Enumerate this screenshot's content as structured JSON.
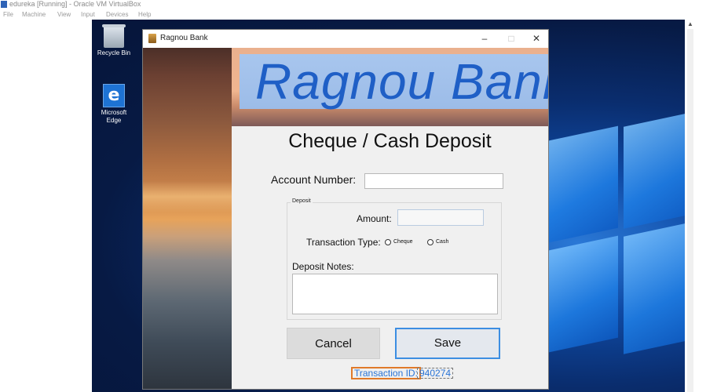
{
  "host": {
    "title": "edureka [Running] - Oracle VM VirtualBox",
    "menu": [
      "File",
      "Machine",
      "View",
      "Input",
      "Devices",
      "Help"
    ]
  },
  "desktop": {
    "icons": [
      {
        "label": "Recycle Bin",
        "icon": "recycle-bin-icon"
      },
      {
        "label": "Microsoft Edge",
        "icon": "edge-icon"
      }
    ]
  },
  "window": {
    "title": "Ragnou Bank",
    "minimize": "–",
    "maximize": "□",
    "close": "✕"
  },
  "banner": {
    "logo_text": "Ragnou Bank"
  },
  "form": {
    "heading": "Cheque / Cash Deposit",
    "account_label": "Account Number:",
    "account_value": "",
    "deposit_group_label": "Deposit",
    "amount_label": "Amount:",
    "amount_value": "",
    "transaction_type_label": "Transaction Type:",
    "radio_cheque": "Cheque",
    "radio_cash": "Cash",
    "notes_label": "Deposit Notes:",
    "notes_value": "",
    "cancel_label": "Cancel",
    "save_label": "Save",
    "transaction_id_label": "Transaction ID:",
    "transaction_id_value": "940274"
  },
  "colors": {
    "accent_blue": "#2a74d6",
    "focus_orange": "#e07a2a",
    "logo_blue": "#1f5fc6"
  }
}
